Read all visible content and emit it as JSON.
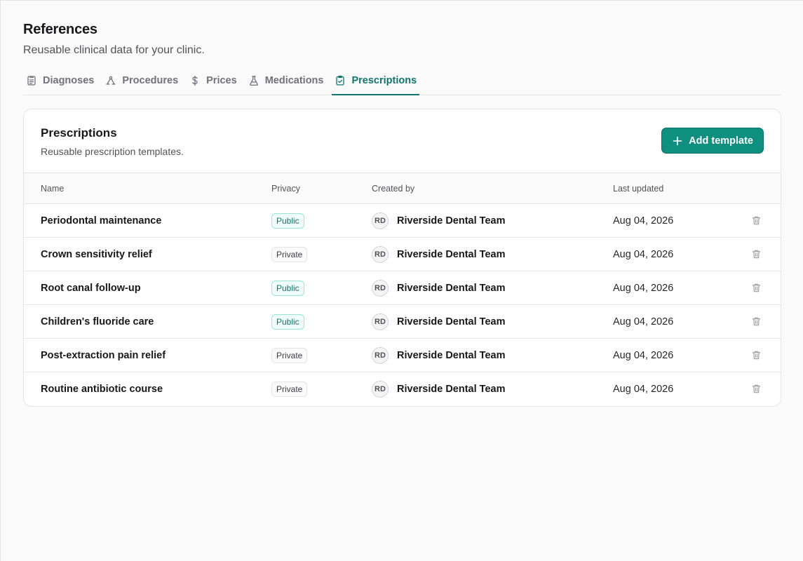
{
  "page": {
    "title": "References",
    "subtitle": "Reusable clinical data for your clinic."
  },
  "tabs": [
    {
      "label": "Diagnoses",
      "icon": "clipboard-list-icon"
    },
    {
      "label": "Procedures",
      "icon": "triangle-nodes-icon"
    },
    {
      "label": "Prices",
      "icon": "dollar-icon"
    },
    {
      "label": "Medications",
      "icon": "flask-icon"
    },
    {
      "label": "Prescriptions",
      "icon": "clipboard-check-icon",
      "active": true
    }
  ],
  "card": {
    "title": "Prescriptions",
    "subtitle": "Reusable prescription templates.",
    "add_label": "Add template"
  },
  "table": {
    "headers": {
      "name": "Name",
      "privacy": "Privacy",
      "created_by": "Created by",
      "last_updated": "Last updated"
    },
    "rows": [
      {
        "name": "Periodontal maintenance",
        "privacy": "Public",
        "initials": "RD",
        "creator": "Riverside Dental Team",
        "updated": "Aug 04, 2026"
      },
      {
        "name": "Crown sensitivity relief",
        "privacy": "Private",
        "initials": "RD",
        "creator": "Riverside Dental Team",
        "updated": "Aug 04, 2026"
      },
      {
        "name": "Root canal follow-up",
        "privacy": "Public",
        "initials": "RD",
        "creator": "Riverside Dental Team",
        "updated": "Aug 04, 2026"
      },
      {
        "name": "Children's fluoride care",
        "privacy": "Public",
        "initials": "RD",
        "creator": "Riverside Dental Team",
        "updated": "Aug 04, 2026"
      },
      {
        "name": "Post-extraction pain relief",
        "privacy": "Private",
        "initials": "RD",
        "creator": "Riverside Dental Team",
        "updated": "Aug 04, 2026"
      },
      {
        "name": "Routine antibiotic course",
        "privacy": "Private",
        "initials": "RD",
        "creator": "Riverside Dental Team",
        "updated": "Aug 04, 2026"
      }
    ]
  },
  "colors": {
    "accent": "#0f766e",
    "button": "#0f8f80",
    "public_badge": "#0f766e"
  }
}
